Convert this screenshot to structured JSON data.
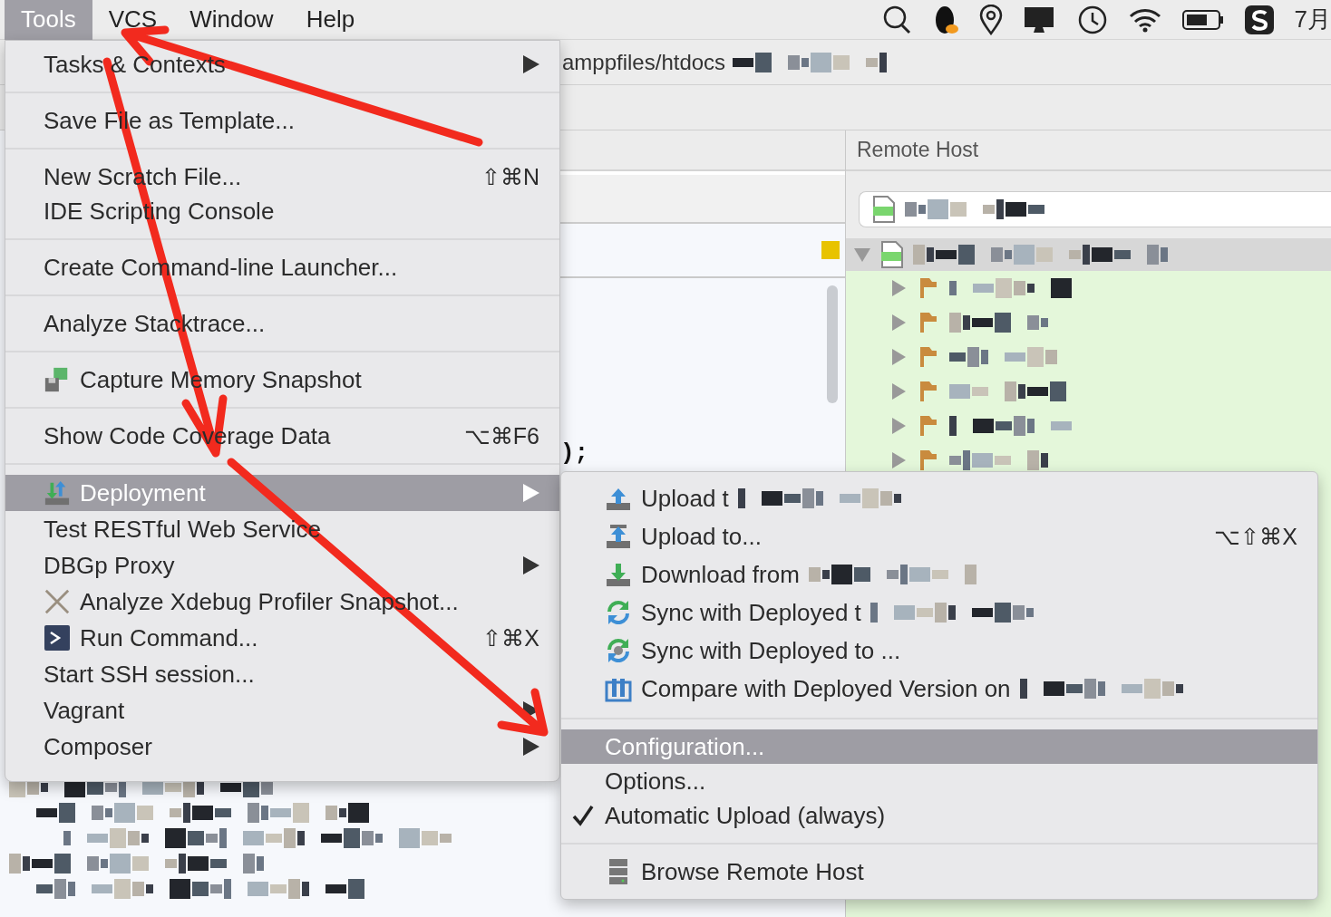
{
  "menu_bar": {
    "items": [
      {
        "label": "Tools",
        "selected": true
      },
      {
        "label": "VCS",
        "selected": false
      },
      {
        "label": "Window",
        "selected": false
      },
      {
        "label": "Help",
        "selected": false
      }
    ],
    "clock": "7月"
  },
  "path_bar": {
    "path": "amppfiles/htdocs"
  },
  "editor": {
    "code_fragment": ");"
  },
  "remote_host": {
    "title": "Remote Host",
    "tree": {
      "expanded": true,
      "selected": true,
      "children": [
        {
          "expanded": false,
          "selected": false
        },
        {
          "expanded": false,
          "selected": false
        },
        {
          "expanded": false,
          "selected": false
        },
        {
          "expanded": false,
          "selected": false
        },
        {
          "expanded": false,
          "selected": false
        },
        {
          "expanded": false,
          "selected": false
        }
      ]
    }
  },
  "tools_menu": {
    "groups": [
      [
        {
          "label": "Tasks & Contexts",
          "submenu": true,
          "selected": false
        }
      ],
      [
        {
          "label": "Save File as Template...",
          "submenu": false,
          "selected": false
        }
      ],
      [
        {
          "label": "New Scratch File...",
          "shortcut": "⇧⌘N",
          "submenu": false,
          "selected": false
        },
        {
          "label": "IDE Scripting Console",
          "submenu": false,
          "selected": false
        }
      ],
      [
        {
          "label": "Create Command-line Launcher...",
          "submenu": false,
          "selected": false
        }
      ],
      [
        {
          "label": "Analyze Stacktrace...",
          "submenu": false,
          "selected": false
        }
      ],
      [
        {
          "label": "Capture Memory Snapshot",
          "kind": "snapshot",
          "submenu": false,
          "selected": false
        }
      ],
      [
        {
          "label": "Show Code Coverage Data",
          "shortcut": "⌥⌘F6",
          "submenu": false,
          "selected": false
        }
      ],
      [
        {
          "label": "Deployment",
          "kind": "deploy",
          "submenu": true,
          "selected": true
        },
        {
          "label": "Test RESTful Web Service",
          "submenu": false,
          "selected": false
        },
        {
          "label": "DBGp Proxy",
          "submenu": true,
          "selected": false
        },
        {
          "label": "Analyze Xdebug Profiler Snapshot...",
          "kind": "xdebug",
          "submenu": false,
          "selected": false
        },
        {
          "label": "Run Command...",
          "kind": "terminal",
          "shortcut": "⇧⌘X",
          "submenu": false,
          "selected": false
        },
        {
          "label": "Start SSH session...",
          "submenu": false,
          "selected": false
        },
        {
          "label": "Vagrant",
          "submenu": true,
          "selected": false
        },
        {
          "label": "Composer",
          "submenu": true,
          "selected": false
        }
      ]
    ]
  },
  "deployment_submenu": {
    "groups": [
      [
        {
          "label": "Upload t",
          "kind": "upload",
          "redacted": true,
          "checked": false,
          "selected": false
        },
        {
          "label": "Upload to...",
          "kind": "upload_to",
          "shortcut": "⌥⇧⌘X",
          "redacted": false,
          "checked": false,
          "selected": false
        },
        {
          "label": "Download from",
          "kind": "download",
          "redacted": true,
          "checked": false,
          "selected": false
        },
        {
          "label": "Sync with Deployed t",
          "kind": "sync",
          "redacted": true,
          "checked": false,
          "selected": false
        },
        {
          "label": "Sync with Deployed to ...",
          "kind": "sync_to",
          "redacted": false,
          "checked": false,
          "selected": false
        },
        {
          "label": "Compare with Deployed Version on",
          "kind": "compare",
          "redacted": true,
          "checked": false,
          "selected": false
        }
      ],
      [
        {
          "label": "Configuration...",
          "redacted": false,
          "checked": false,
          "selected": true
        },
        {
          "label": "Options...",
          "redacted": false,
          "checked": false,
          "selected": false
        },
        {
          "label": "Automatic Upload (always)",
          "redacted": false,
          "checked": true,
          "selected": false
        }
      ],
      [
        {
          "label": "Browse Remote Host",
          "kind": "server",
          "redacted": false,
          "checked": false,
          "selected": false
        }
      ]
    ]
  }
}
